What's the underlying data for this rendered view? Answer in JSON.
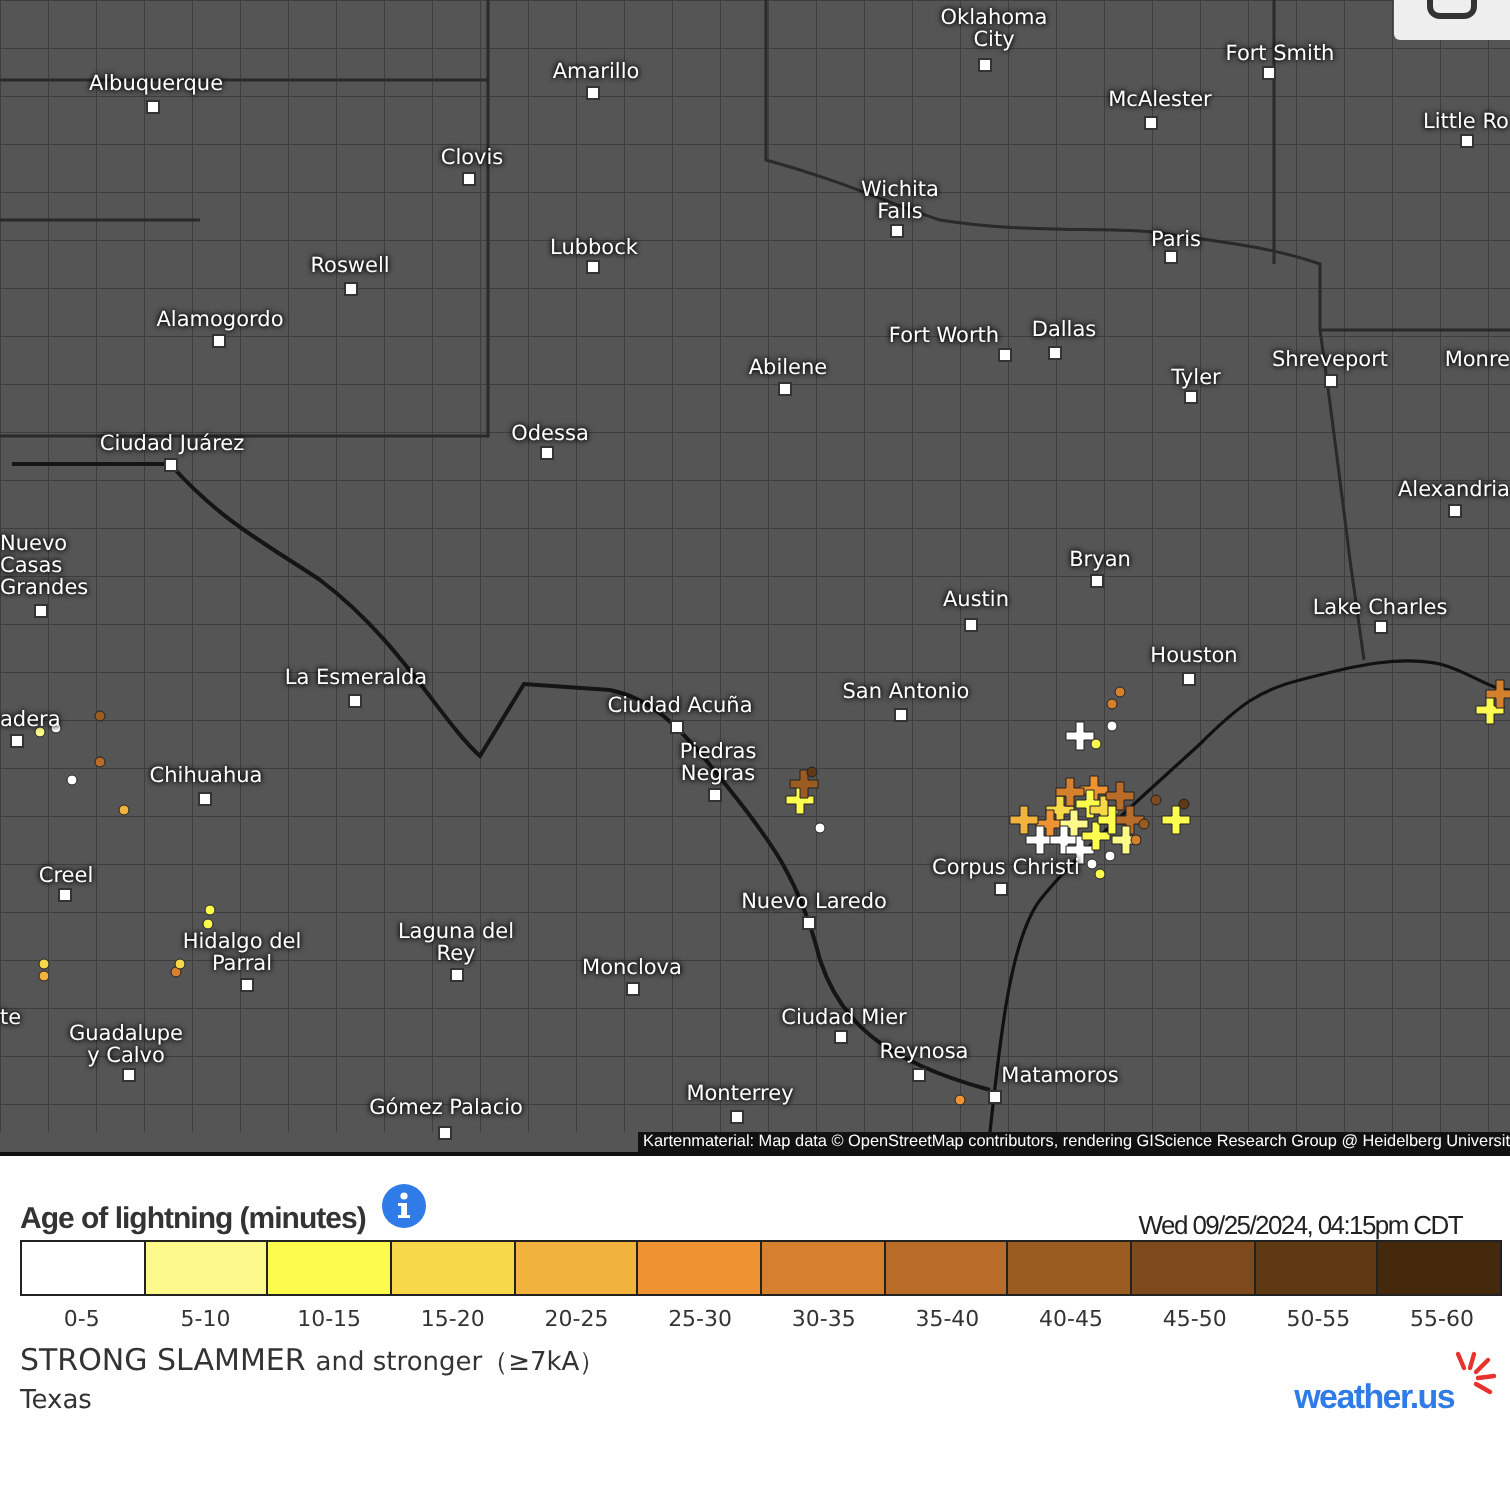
{
  "map": {
    "cities": [
      {
        "name": "Oklahoma City"
      },
      {
        "name": "Fort Smith"
      },
      {
        "name": "Albuquerque"
      },
      {
        "name": "Amarillo"
      },
      {
        "name": "McAlester"
      },
      {
        "name": "Little Ro"
      },
      {
        "name": "Clovis"
      },
      {
        "name": "Wichita Falls"
      },
      {
        "name": "Roswell"
      },
      {
        "name": "Lubbock"
      },
      {
        "name": "Paris"
      },
      {
        "name": "Alamogordo"
      },
      {
        "name": "Fort Worth"
      },
      {
        "name": "Dallas"
      },
      {
        "name": "Shreveport"
      },
      {
        "name": "Monre"
      },
      {
        "name": "Abilene"
      },
      {
        "name": "Tyler"
      },
      {
        "name": "Odessa"
      },
      {
        "name": "Ciudad Juárez"
      },
      {
        "name": "Alexandria"
      },
      {
        "name": "Nuevo Casas Grandes"
      },
      {
        "name": "Bryan"
      },
      {
        "name": "Austin"
      },
      {
        "name": "Lake Charles"
      },
      {
        "name": "La Esmeralda"
      },
      {
        "name": "Houston"
      },
      {
        "name": "Ciudad Acuña"
      },
      {
        "name": "San Antonio"
      },
      {
        "name": "adera"
      },
      {
        "name": "Chihuahua"
      },
      {
        "name": "Piedras Negras"
      },
      {
        "name": "Creel"
      },
      {
        "name": "Corpus Christi"
      },
      {
        "name": "Nuevo Laredo"
      },
      {
        "name": "Hidalgo del Parral"
      },
      {
        "name": "Laguna del Rey"
      },
      {
        "name": "Monclova"
      },
      {
        "name": "te"
      },
      {
        "name": "Ciudad Mier"
      },
      {
        "name": "Guadalupe y Calvo"
      },
      {
        "name": "Reynosa"
      },
      {
        "name": "Matamoros"
      },
      {
        "name": "Monterrey"
      },
      {
        "name": "Gómez Palacio"
      }
    ],
    "attribution": "Kartenmaterial: Map data © OpenStreetMap contributors, rendering GIScience Research Group @ Heidelberg Universit"
  },
  "legend": {
    "title": "Age of lightning (minutes)",
    "timestamp": "Wed 09/25/2024, 04:15pm CDT",
    "scale": [
      {
        "label": "0-5",
        "color": "#ffffff"
      },
      {
        "label": "5-10",
        "color": "#fdf98a"
      },
      {
        "label": "10-15",
        "color": "#fcfb4e"
      },
      {
        "label": "15-20",
        "color": "#f6d848"
      },
      {
        "label": "20-25",
        "color": "#f2b33e"
      },
      {
        "label": "25-30",
        "color": "#ef9232"
      },
      {
        "label": "30-35",
        "color": "#d5802d"
      },
      {
        "label": "35-40",
        "color": "#b96c27"
      },
      {
        "label": "40-45",
        "color": "#9b5c22"
      },
      {
        "label": "45-50",
        "color": "#7e4a1b"
      },
      {
        "label": "50-55",
        "color": "#5f3814"
      },
      {
        "label": "55-60",
        "color": "#45290d"
      }
    ],
    "strength": "STRONG SLAMMER",
    "strength_note": "and stronger（≥7kA）",
    "region": "Texas",
    "logo": "weather.us"
  }
}
